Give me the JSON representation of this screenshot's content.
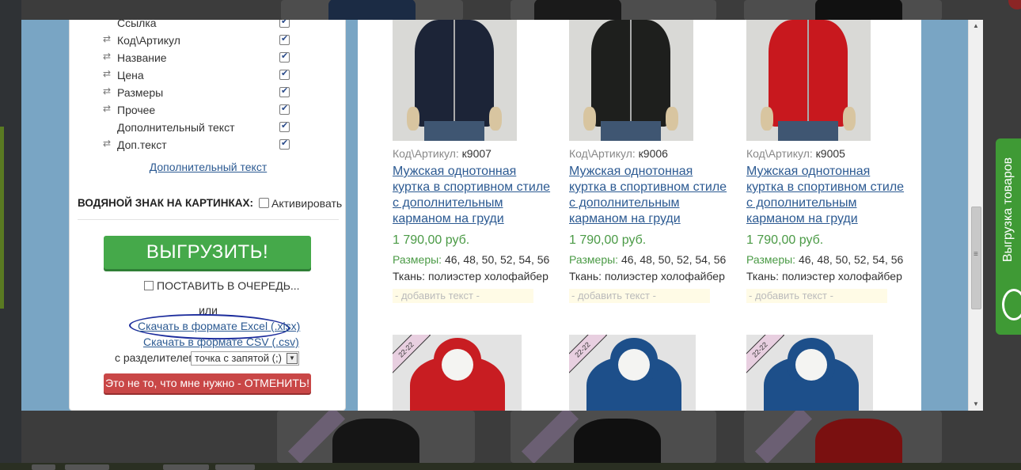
{
  "fields": [
    {
      "label": "Ссылка",
      "draggable": false,
      "checked": true
    },
    {
      "label": "Код\\Артикул",
      "draggable": true,
      "checked": true
    },
    {
      "label": "Название",
      "draggable": true,
      "checked": true
    },
    {
      "label": "Цена",
      "draggable": true,
      "checked": true
    },
    {
      "label": "Размеры",
      "draggable": true,
      "checked": true
    },
    {
      "label": "Прочее",
      "draggable": true,
      "checked": true
    },
    {
      "label": "Дополнительный текст",
      "draggable": false,
      "checked": true
    },
    {
      "label": "Доп.текст",
      "draggable": true,
      "checked": true
    }
  ],
  "left": {
    "extra_text_link": "Дополнительный текст",
    "watermark_label": "ВОДЯНОЙ ЗНАК НА КАРТИНКАХ:",
    "watermark_activate": "Активировать",
    "export_button": "ВЫГРУЗИТЬ!",
    "queue_label": "ПОСТАВИТЬ В ОЧЕРЕДЬ...",
    "or_text": "или",
    "download_xlsx": "Скачать в формате Excel (.xlsx)",
    "download_csv": "Скачать в формате CSV (.csv)",
    "separator_label": "с разделителем",
    "separator_value": "точка с запятой (;)",
    "cancel_button": "Это не то, что мне нужно - ОТМЕНИТЬ!"
  },
  "products": [
    {
      "art_label": "Код\\Артикул:",
      "art_value": "к9007",
      "title": "Мужская однотонная куртка в спортивном стиле с дополнительным карманом на груди",
      "price": "1 790,00 руб.",
      "sizes_label": "Размеры:",
      "sizes_value": "46, 48, 50, 52, 54, 56",
      "fabric": "Ткань: полиэстер холофайбер",
      "add_text": "- добавить текст -",
      "color": "#1c2437"
    },
    {
      "art_label": "Код\\Артикул:",
      "art_value": "к9006",
      "title": "Мужская однотонная куртка в спортивном стиле с дополнительным карманом на груди",
      "price": "1 790,00 руб.",
      "sizes_label": "Размеры:",
      "sizes_value": "46, 48, 50, 52, 54, 56",
      "fabric": "Ткань: полиэстер холофайбер",
      "add_text": "- добавить текст -",
      "color": "#1e1f1d"
    },
    {
      "art_label": "Код\\Артикул:",
      "art_value": "к9005",
      "title": "Мужская однотонная куртка в спортивном стиле с дополнительным карманом на груди",
      "price": "1 790,00 руб.",
      "sizes_label": "Размеры:",
      "sizes_value": "46, 48, 50, 52, 54, 56",
      "fabric": "Ткань: полиэстер холофайбер",
      "add_text": "- добавить текст -",
      "color": "#c8181e"
    }
  ],
  "next_row": [
    {
      "tag": "22-22",
      "color": "#c81d22"
    },
    {
      "tag": "22-22",
      "color": "#1d4f8a"
    },
    {
      "tag": "22-22",
      "color": "#1d4f8a"
    }
  ],
  "side_tab": {
    "label": "Выгрузка товаров"
  },
  "colors": {
    "accent_green": "#45a94a",
    "cancel_red": "#c94747",
    "link_blue": "#2c5a92",
    "modal_frame": "#79a5c4"
  }
}
